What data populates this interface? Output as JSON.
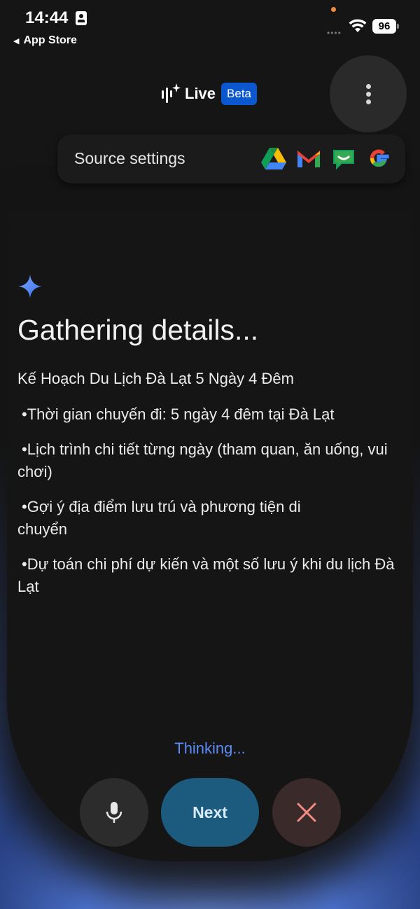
{
  "status_bar": {
    "time": "14:44",
    "back_label": "App Store",
    "battery": "96"
  },
  "header": {
    "live_label": "Live",
    "beta_badge": "Beta",
    "more_icon": "more-vert-icon"
  },
  "source_settings": {
    "label": "Source settings",
    "icons": [
      "google-drive-icon",
      "gmail-icon",
      "chat-icon",
      "google-icon"
    ]
  },
  "content": {
    "heading": "Gathering details...",
    "title": "Kế Hoạch Du Lịch Đà Lạt 5 Ngày 4 Đêm",
    "bullets": [
      "Thời gian chuyến đi: 5 ngày 4 đêm tại Đà Lạt",
      "Lịch trình chi tiết từng ngày (tham quan, ăn uống, vui chơi)",
      "Gợi ý địa điểm lưu trú và phương tiện di chuyển",
      "Dự toán chi phí dự kiến và một số lưu ý khi du lịch Đà Lạt"
    ]
  },
  "footer": {
    "status": "Thinking...",
    "next_label": "Next",
    "mic_icon": "microphone-icon",
    "close_icon": "close-icon"
  },
  "colors": {
    "accent_blue": "#0b57d0",
    "thinking": "#5b8cf5",
    "next_button": "#1c5b7d",
    "close_x": "#f28b82"
  }
}
